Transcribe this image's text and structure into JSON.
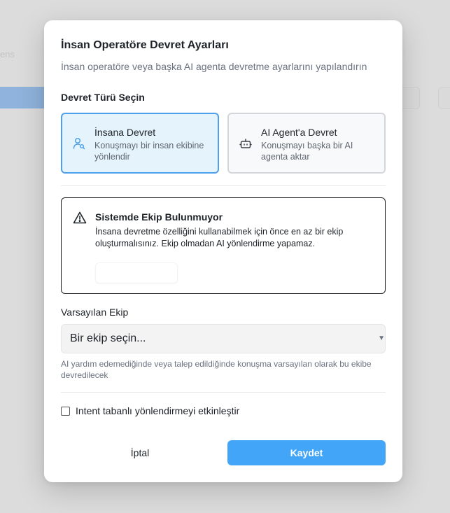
{
  "background": {
    "faint_text": "ens"
  },
  "modal": {
    "title": "İnsan Operatöre Devret Ayarları",
    "subtitle": "İnsan operatöre veya başka AI agenta devretme ayarlarını yapılandırın",
    "handoff_type_label": "Devret Türü Seçin",
    "handoff_options": [
      {
        "title": "İnsana Devret",
        "description": "Konuşmayı bir insan ekibine yönlendir",
        "icon": "user-search-icon",
        "selected": true
      },
      {
        "title": "AI Agent'a Devret",
        "description": "Konuşmayı başka bir AI agenta aktar",
        "icon": "bot-icon",
        "selected": false
      }
    ],
    "alert": {
      "icon": "warning-icon",
      "title": "Sistemde Ekip Bulunmuyor",
      "body": "İnsana devretme özelliğini kullanabilmek için önce en az bir ekip oluşturmalısınız. Ekip olmadan AI yönlendirme yapamaz."
    },
    "default_team": {
      "label": "Varsayılan Ekip",
      "placeholder": "Bir ekip seçin...",
      "helper": "AI yardım edemediğinde veya talep edildiğinde konuşma varsayılan olarak bu ekibe devredilecek"
    },
    "intent_checkbox": {
      "label": "Intent tabanlı yönlendirmeyi etkinleştir",
      "checked": false
    },
    "buttons": {
      "cancel": "İptal",
      "save": "Kaydet"
    }
  },
  "colors": {
    "accent": "#42a5f8",
    "selected_card_border": "#4ea0ea",
    "selected_card_bg": "#e5f3fc"
  }
}
